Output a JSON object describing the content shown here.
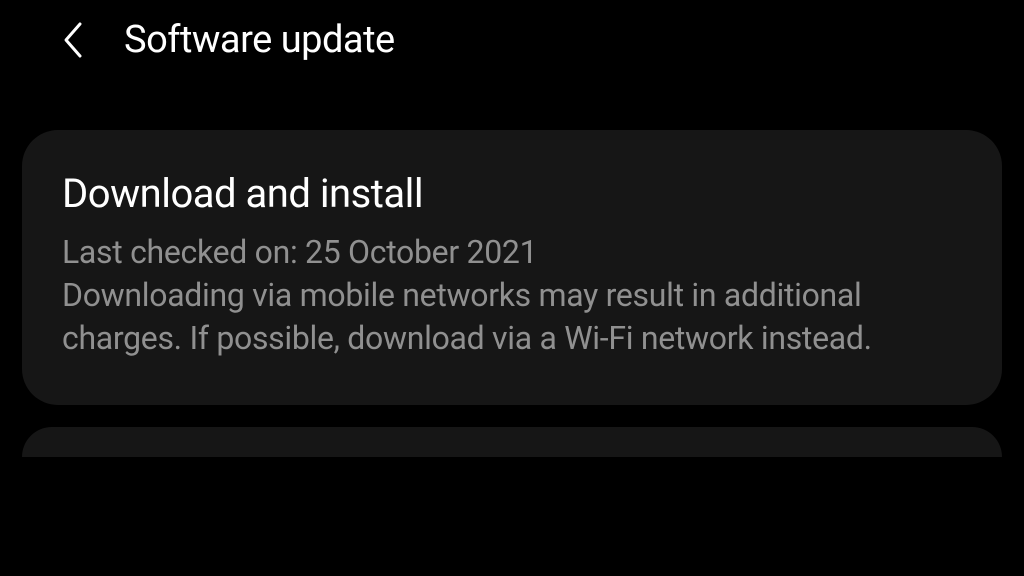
{
  "header": {
    "title": "Software update"
  },
  "download_card": {
    "title": "Download and install",
    "last_checked": "Last checked on: 25 October 2021",
    "description": "Downloading via mobile networks may result in additional charges. If possible, download via a Wi-Fi network instead."
  }
}
